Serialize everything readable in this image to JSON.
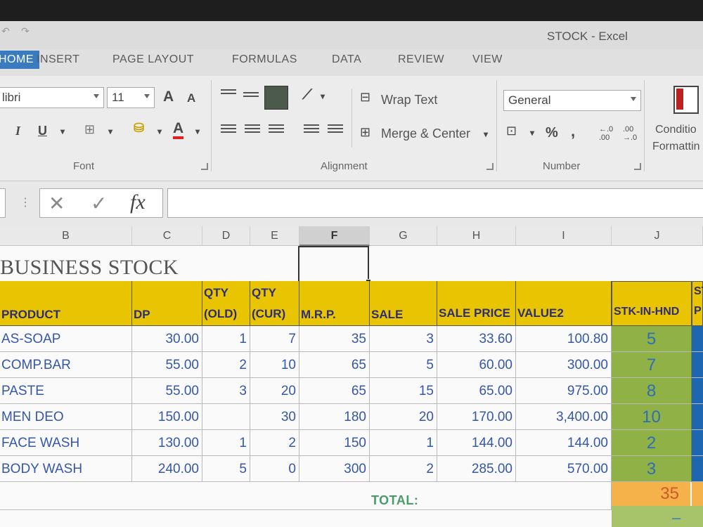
{
  "window": {
    "title": "STOCK - Excel"
  },
  "tabs": [
    "HOME",
    "INSERT",
    "PAGE LAYOUT",
    "FORMULAS",
    "DATA",
    "REVIEW",
    "VIEW"
  ],
  "ribbon": {
    "font_name": "libri",
    "font_size": "11",
    "font_group": "Font",
    "alignment_group": "Alignment",
    "number_group": "Number",
    "wrap_text": "Wrap Text",
    "merge_center": "Merge & Center",
    "number_format": "General",
    "percent": "%",
    "comma": ",",
    "conditional_1": "Conditio",
    "conditional_2": "Formattin",
    "grow_font": "A",
    "shrink_font": "A",
    "italic": "I",
    "underline": "U",
    "font_color": "A"
  },
  "formula_bar": {
    "fx": "fx",
    "cancel": "✕",
    "enter": "✓",
    "value": ""
  },
  "columns": [
    "B",
    "C",
    "D",
    "E",
    "F",
    "G",
    "H",
    "I",
    "J"
  ],
  "sheet": {
    "title": "BUSINESS STOCK",
    "headers": {
      "product": "PRODUCT",
      "dp": "DP",
      "qty_old_1": "QTY",
      "qty_old_2": "(OLD)",
      "qty_cur_1": "QTY",
      "qty_cur_2": "(CUR)",
      "mrp": "M.R.P.",
      "sale": "SALE",
      "sale_price": "SALE PRICE",
      "value2": "VALUE2",
      "stk": "STK-IN-HND",
      "k_top": "ST",
      "k_bottom": "P"
    },
    "rows": [
      {
        "product": "AS-SOAP",
        "dp": "30.00",
        "qty_old": "1",
        "qty_cur": "7",
        "mrp": "35",
        "sale": "3",
        "sale_price": "33.60",
        "value2": "100.80",
        "stk": "5"
      },
      {
        "product": "COMP.BAR",
        "dp": "55.00",
        "qty_old": "2",
        "qty_cur": "10",
        "mrp": "65",
        "sale": "5",
        "sale_price": "60.00",
        "value2": "300.00",
        "stk": "7"
      },
      {
        "product": "PASTE",
        "dp": "55.00",
        "qty_old": "3",
        "qty_cur": "20",
        "mrp": "65",
        "sale": "15",
        "sale_price": "65.00",
        "value2": "975.00",
        "stk": "8"
      },
      {
        "product": "MEN DEO",
        "dp": "150.00",
        "qty_old": "",
        "qty_cur": "30",
        "mrp": "180",
        "sale": "20",
        "sale_price": "170.00",
        "value2": "3,400.00",
        "stk": "10"
      },
      {
        "product": "FACE WASH",
        "dp": "130.00",
        "qty_old": "1",
        "qty_cur": "2",
        "mrp": "150",
        "sale": "1",
        "sale_price": "144.00",
        "value2": "144.00",
        "stk": "2"
      },
      {
        "product": "BODY WASH",
        "dp": "240.00",
        "qty_old": "5",
        "qty_cur": "0",
        "mrp": "300",
        "sale": "2",
        "sale_price": "285.00",
        "value2": "570.00",
        "stk": "3"
      }
    ],
    "total_label": "TOTAL:",
    "total_stk": "35",
    "below_mark": "–"
  },
  "colors": {
    "header_yellow": "#e9c400",
    "stock_green": "#8fb146",
    "total_orange": "#f5b14a",
    "accent_blue": "#1e66b0"
  }
}
